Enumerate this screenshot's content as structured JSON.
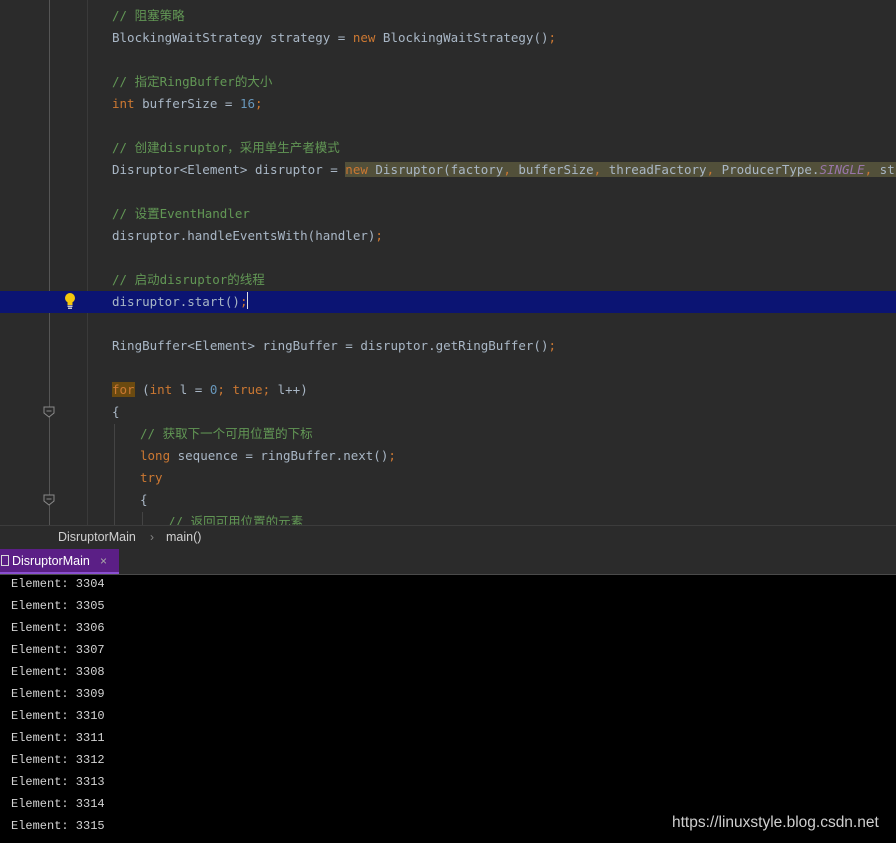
{
  "editor": {
    "lines": {
      "c1": "// 阻塞策略",
      "l1_type": "BlockingWaitStrategy strategy = ",
      "l1_new": "new",
      "l1_rest": " BlockingWaitStrategy()",
      "l1_semi": ";",
      "c2": "// 指定RingBuffer的大小",
      "l2_kw": "int",
      "l2_mid": " bufferSize = ",
      "l2_num": "16",
      "l2_semi": ";",
      "c3": "// 创建disruptor，采用单生产者模式",
      "l3_a": "Disruptor<Element> disruptor = ",
      "l3_new": "new",
      "l3_b": " Disruptor(factory",
      "l3_c1": ",",
      "l3_c": " bufferSize",
      "l3_c2": ",",
      "l3_d": " threadFactory",
      "l3_c3": ",",
      "l3_e": " ProducerType.",
      "l3_static": "SINGLE",
      "l3_c4": ",",
      "l3_f": " strategy)",
      "l3_semi": ";",
      "c4": "// 设置EventHandler",
      "l4": "disruptor.handleEventsWith(handler)",
      "l4_semi": ";",
      "c5": "// 启动disruptor的线程",
      "l5": "disruptor.start()",
      "l5_semi": ";",
      "l6": "RingBuffer<Element> ringBuffer = disruptor.getRingBuffer()",
      "l6_semi": ";",
      "l7_for": "for",
      "l7_a": " (",
      "l7_int": "int",
      "l7_b": " l = ",
      "l7_zero": "0",
      "l7_s1": "; ",
      "l7_true": "true",
      "l7_s2": "; ",
      "l7_c": "l++)",
      "l8": "{",
      "c6": "// 获取下一个可用位置的下标",
      "l9_kw": "long",
      "l9_rest": " sequence = ringBuffer.next()",
      "l9_semi": ";",
      "l10": "try",
      "l11": "{",
      "c7": "// 返回可用位置的元素"
    }
  },
  "breadcrumb": {
    "class_name": "DisruptorMain",
    "separator": "›",
    "method_name": "main()"
  },
  "run_tab": {
    "label": "DisruptorMain",
    "close": "×"
  },
  "console": {
    "lines": [
      "Element: 3304",
      "Element: 3305",
      "Element: 3306",
      "Element: 3307",
      "Element: 3308",
      "Element: 3309",
      "Element: 3310",
      "Element: 3311",
      "Element: 3312",
      "Element: 3313",
      "Element: 3314",
      "Element: 3315"
    ]
  },
  "watermark": "https://linuxstyle.blog.csdn.net",
  "icons": {
    "gutter_bulb": "lightbulb-icon",
    "fold_markers": "fold-icon",
    "tab_icon": "console-tab-icon",
    "tab_close": "close-icon"
  },
  "colors": {
    "editor_bg": "#2b2b2b",
    "comment": "#629755",
    "keyword": "#cc7832",
    "number": "#6897bb",
    "current_line": "#0b1473",
    "tab_active": "#5b1f86"
  }
}
